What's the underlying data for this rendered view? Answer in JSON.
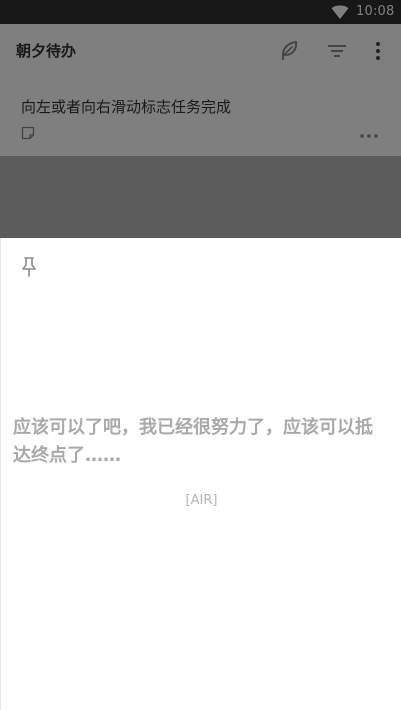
{
  "status_bar": {
    "time": "10:08",
    "wifi_icon": "wifi-icon"
  },
  "app_bar": {
    "title": "朝夕待办",
    "actions": [
      "leaf-icon",
      "filter-icon",
      "more-vert-icon"
    ]
  },
  "task": {
    "title": "向左或者向右滑动标志任务完成",
    "note_icon": "note-icon",
    "more_icon": "more-horiz-icon"
  },
  "sheet": {
    "pin_icon": "pin-icon",
    "quote": "应该可以了吧，我已经很努力了，应该可以抵达终点了……",
    "tag": "[AIR]"
  },
  "colors": {
    "status_bar": "#2f2f2f",
    "scrim": "rgba(0,0,0,0.5)",
    "quote_text": "#a9a9a9",
    "icon_gray": "#888888"
  }
}
